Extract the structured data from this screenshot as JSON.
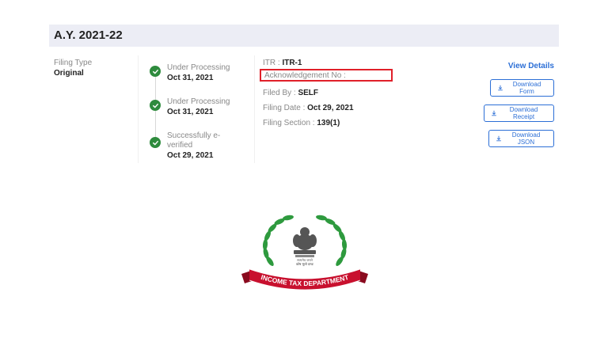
{
  "header": {
    "title": "A.Y. 2021-22"
  },
  "filing": {
    "type_label": "Filing Type",
    "type_value": "Original"
  },
  "timeline": [
    {
      "status": "Under Processing",
      "date": "Oct 31, 2021"
    },
    {
      "status": "Under Processing",
      "date": "Oct 31, 2021"
    },
    {
      "status": "Successfully e-verified",
      "date": "Oct 29, 2021"
    }
  ],
  "details": {
    "itr_label": "ITR : ",
    "itr_value": "ITR-1",
    "ack_label": "Acknowledgement No : ",
    "filed_by_label": "Filed By : ",
    "filed_by_value": "SELF",
    "filing_date_label": "Filing Date : ",
    "filing_date_value": "Oct 29, 2021",
    "section_label": "Filing Section : ",
    "section_value": "139(1)"
  },
  "actions": {
    "view_details": "View Details",
    "download_form": "Download Form",
    "download_receipt": "Download Receipt",
    "download_json": "Download JSON"
  },
  "logo": {
    "text": "INCOME TAX DEPARTMENT",
    "motto": "कोष मूलो दण्डः",
    "emblem_caption": "सत्यमेव जयते"
  },
  "colors": {
    "accent": "#2c6fd6",
    "check_green": "#2e8b3d",
    "highlight_red": "#e0202a",
    "header_bg": "#ecedf5",
    "logo_red": "#c8102e",
    "wreath_green": "#2e9a3e"
  }
}
